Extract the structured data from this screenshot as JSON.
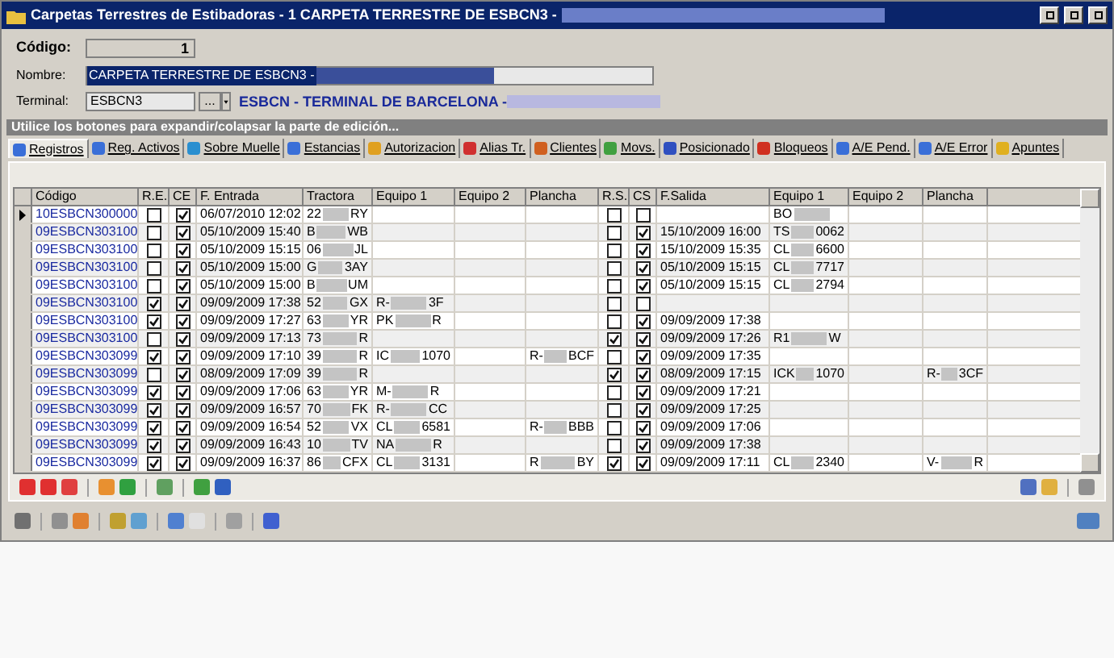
{
  "window": {
    "title": "Carpetas Terrestres de Estibadoras - 1  CARPETA TERRESTRE DE ESBCN3 -"
  },
  "form": {
    "codigo_label": "Código:",
    "codigo": "1",
    "nombre_label": "Nombre:",
    "nombre": "CARPETA TERRESTRE DE ESBCN3 -",
    "terminal_label": "Terminal:",
    "terminal": "ESBCN3",
    "browse": "...",
    "terminal_name": "ESBCN - TERMINAL DE BARCELONA -"
  },
  "info_bar": "Utilice los botones para expandir/colapsar la parte de edición...",
  "tabs": [
    {
      "label": "Registros",
      "selected": true
    },
    {
      "label": "Reg. Activos",
      "selected": false
    },
    {
      "label": "Sobre Muelle",
      "selected": false
    },
    {
      "label": "Estancias",
      "selected": false
    },
    {
      "label": "Autorizacion",
      "selected": false
    },
    {
      "label": "Alias Tr.",
      "selected": false
    },
    {
      "label": "Clientes",
      "selected": false
    },
    {
      "label": "Movs.",
      "selected": false
    },
    {
      "label": "Posicionado",
      "selected": false
    },
    {
      "label": "Bloqueos",
      "selected": false
    },
    {
      "label": "A/E Pend.",
      "selected": false
    },
    {
      "label": "A/E Error",
      "selected": false
    },
    {
      "label": "Apuntes",
      "selected": false
    }
  ],
  "table": {
    "columns": [
      "Código",
      "R.E.",
      "CE",
      "F. Entrada",
      "Tractora",
      "Equipo 1",
      "Equipo 2",
      "Plancha",
      "R.S.",
      "CS",
      "F.Salida",
      "Equipo 1",
      "Equipo 2",
      "Plancha"
    ],
    "rows": [
      {
        "selected": true,
        "codigo": "10ESBCN300000",
        "re": false,
        "ce": true,
        "entrada": "06/07/2010 12:02",
        "tractora": [
          "22",
          "RY"
        ],
        "eq1": [],
        "eq2": [],
        "plancha": [],
        "rs": false,
        "cs": false,
        "salida": "",
        "eq1s": [
          "BO"
        ],
        "eq2s": [],
        "planchas": []
      },
      {
        "selected": false,
        "codigo": "09ESBCN303100",
        "re": false,
        "ce": true,
        "entrada": "05/10/2009 15:40",
        "tractora": [
          "B",
          "WB"
        ],
        "eq1": [],
        "eq2": [],
        "plancha": [],
        "rs": false,
        "cs": true,
        "salida": "15/10/2009 16:00",
        "eq1s": [
          "TS",
          "0062"
        ],
        "eq2s": [],
        "planchas": []
      },
      {
        "selected": false,
        "codigo": "09ESBCN303100",
        "re": false,
        "ce": true,
        "entrada": "05/10/2009 15:15",
        "tractora": [
          "06",
          "JL"
        ],
        "eq1": [],
        "eq2": [],
        "plancha": [],
        "rs": false,
        "cs": true,
        "salida": "15/10/2009 15:35",
        "eq1s": [
          "CL",
          "6600"
        ],
        "eq2s": [],
        "planchas": []
      },
      {
        "selected": false,
        "codigo": "09ESBCN303100",
        "re": false,
        "ce": true,
        "entrada": "05/10/2009 15:00",
        "tractora": [
          "G",
          "3AY"
        ],
        "eq1": [],
        "eq2": [],
        "plancha": [],
        "rs": false,
        "cs": true,
        "salida": "05/10/2009 15:15",
        "eq1s": [
          "CL",
          "7717"
        ],
        "eq2s": [],
        "planchas": []
      },
      {
        "selected": false,
        "codigo": "09ESBCN303100",
        "re": false,
        "ce": true,
        "entrada": "05/10/2009 15:00",
        "tractora": [
          "B",
          "UM"
        ],
        "eq1": [],
        "eq2": [],
        "plancha": [],
        "rs": false,
        "cs": true,
        "salida": "05/10/2009 15:15",
        "eq1s": [
          "CL",
          "2794"
        ],
        "eq2s": [],
        "planchas": []
      },
      {
        "selected": false,
        "codigo": "09ESBCN303100",
        "re": true,
        "ce": true,
        "entrada": "09/09/2009 17:38",
        "tractora": [
          "52",
          "GX"
        ],
        "eq1": [
          "R-",
          "3F"
        ],
        "eq2": [],
        "plancha": [],
        "rs": false,
        "cs": false,
        "salida": "",
        "eq1s": [],
        "eq2s": [],
        "planchas": []
      },
      {
        "selected": false,
        "codigo": "09ESBCN303100",
        "re": true,
        "ce": true,
        "entrada": "09/09/2009 17:27",
        "tractora": [
          "63",
          "YR"
        ],
        "eq1": [
          "PK",
          "R"
        ],
        "eq2": [],
        "plancha": [],
        "rs": false,
        "cs": true,
        "salida": "09/09/2009 17:38",
        "eq1s": [],
        "eq2s": [],
        "planchas": []
      },
      {
        "selected": false,
        "codigo": "09ESBCN303100",
        "re": false,
        "ce": true,
        "entrada": "09/09/2009 17:13",
        "tractora": [
          "73",
          "R"
        ],
        "eq1": [],
        "eq2": [],
        "plancha": [],
        "rs": true,
        "cs": true,
        "salida": "09/09/2009 17:26",
        "eq1s": [
          "R1",
          "W"
        ],
        "eq2s": [],
        "planchas": []
      },
      {
        "selected": false,
        "codigo": "09ESBCN303099",
        "re": true,
        "ce": true,
        "entrada": "09/09/2009 17:10",
        "tractora": [
          "39",
          "R"
        ],
        "eq1": [
          "IC",
          "1070"
        ],
        "eq2": [],
        "plancha": [
          "R-",
          "BCF"
        ],
        "rs": false,
        "cs": true,
        "salida": "09/09/2009 17:35",
        "eq1s": [],
        "eq2s": [],
        "planchas": []
      },
      {
        "selected": false,
        "codigo": "09ESBCN303099",
        "re": false,
        "ce": true,
        "entrada": "08/09/2009 17:09",
        "tractora": [
          "39",
          "R"
        ],
        "eq1": [],
        "eq2": [],
        "plancha": [],
        "rs": true,
        "cs": true,
        "salida": "08/09/2009 17:15",
        "eq1s": [
          "ICK",
          "1070"
        ],
        "eq2s": [],
        "planchas": [
          "R-",
          "3CF"
        ]
      },
      {
        "selected": false,
        "codigo": "09ESBCN303099",
        "re": true,
        "ce": true,
        "entrada": "09/09/2009 17:06",
        "tractora": [
          "63",
          "YR"
        ],
        "eq1": [
          "M-",
          "R"
        ],
        "eq2": [],
        "plancha": [],
        "rs": false,
        "cs": true,
        "salida": "09/09/2009 17:21",
        "eq1s": [],
        "eq2s": [],
        "planchas": []
      },
      {
        "selected": false,
        "codigo": "09ESBCN303099",
        "re": true,
        "ce": true,
        "entrada": "09/09/2009 16:57",
        "tractora": [
          "70",
          "FK"
        ],
        "eq1": [
          "R-",
          "CC"
        ],
        "eq2": [],
        "plancha": [],
        "rs": false,
        "cs": true,
        "salida": "09/09/2009 17:25",
        "eq1s": [],
        "eq2s": [],
        "planchas": []
      },
      {
        "selected": false,
        "codigo": "09ESBCN303099",
        "re": true,
        "ce": true,
        "entrada": "09/09/2009 16:54",
        "tractora": [
          "52",
          "VX"
        ],
        "eq1": [
          "CL",
          "6581"
        ],
        "eq2": [],
        "plancha": [
          "R-",
          "BBB"
        ],
        "rs": false,
        "cs": true,
        "salida": "09/09/2009 17:06",
        "eq1s": [],
        "eq2s": [],
        "planchas": []
      },
      {
        "selected": false,
        "codigo": "09ESBCN303099",
        "re": true,
        "ce": true,
        "entrada": "09/09/2009 16:43",
        "tractora": [
          "10",
          "TV"
        ],
        "eq1": [
          "NA",
          "R"
        ],
        "eq2": [],
        "plancha": [],
        "rs": false,
        "cs": true,
        "salida": "09/09/2009 17:38",
        "eq1s": [],
        "eq2s": [],
        "planchas": []
      },
      {
        "selected": false,
        "codigo": "09ESBCN303099",
        "re": true,
        "ce": true,
        "entrada": "09/09/2009 16:37",
        "tractora": [
          "86",
          "CFX"
        ],
        "eq1": [
          "CL",
          "3131"
        ],
        "eq2": [],
        "plancha": [
          "R",
          "BY"
        ],
        "rs": true,
        "cs": true,
        "salida": "09/09/2009 17:11",
        "eq1s": [
          "CL",
          "2340"
        ],
        "eq2s": [],
        "planchas": [
          "V-",
          "R"
        ]
      }
    ]
  }
}
